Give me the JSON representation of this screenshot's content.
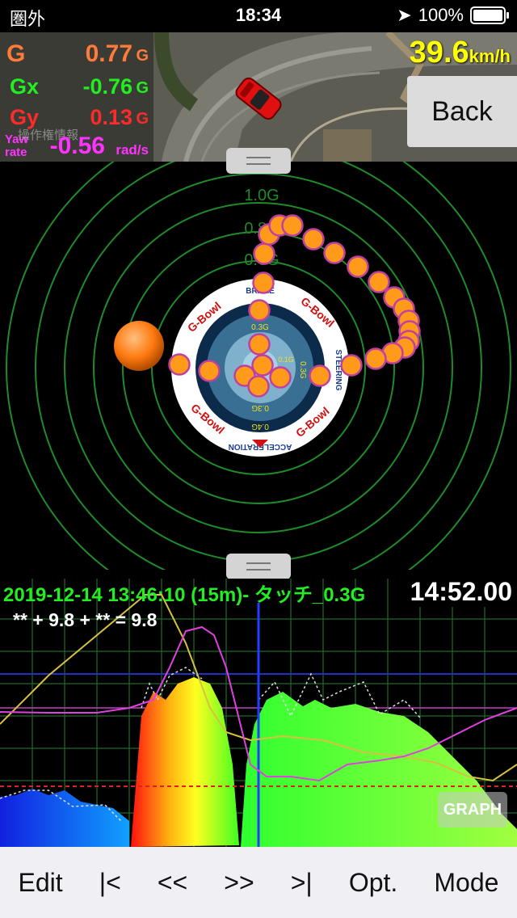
{
  "status_bar": {
    "carrier": "圏外",
    "time": "18:34",
    "battery": "100%"
  },
  "hud": {
    "g_label": "G",
    "g_value": "0.77",
    "g_unit": "G",
    "gx_label": "Gx",
    "gx_value": "-0.76",
    "gx_unit": "G",
    "gy_label": "Gy",
    "gy_value": "0.13",
    "gy_unit": "G",
    "yaw_label_1": "Yaw",
    "yaw_label_2": "rate",
    "yaw_value": "-0.56",
    "yaw_unit": "rad/s",
    "map_text": "操作権情報"
  },
  "speed": {
    "value": "39.6",
    "unit": "km/h"
  },
  "back_label": "Back",
  "gbowl": {
    "rings": [
      "1.0G",
      "0.8G",
      "0.6G"
    ],
    "brand": "G-Bowl",
    "labels": {
      "top": "BRAKE",
      "right": "STEERING",
      "bottom": "ACCELERATION"
    },
    "inner": "0.3G",
    "inner2": "0.1G",
    "inner3": "0.4G"
  },
  "graph": {
    "title": "2019-12-14 13:46:10 (15m)- タッチ_0.3G",
    "time": "14:52.00",
    "formula": "** + 9.8 + ** = 9.8",
    "button": "GRAPH"
  },
  "toolbar": [
    "Edit",
    "|<",
    "<<",
    ">>",
    ">|",
    "Opt.",
    "Mode"
  ],
  "colors": {
    "g": "#ff7b3a",
    "gx": "#22ee22",
    "gy": "#ff2a2a",
    "yaw": "#ff33ff",
    "speed": "#ffff00",
    "ring": "#1f8a2a",
    "dot": "#ff9a1a",
    "graph_title": "#22ee22"
  }
}
